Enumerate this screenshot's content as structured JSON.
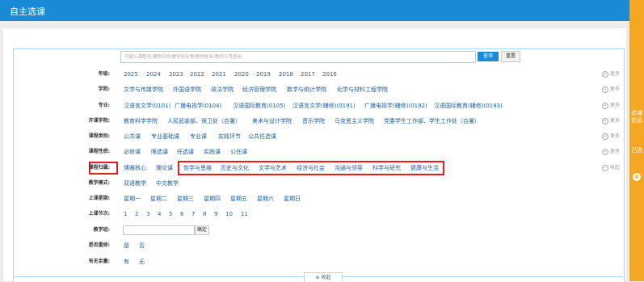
{
  "header": {
    "title": "自主选课"
  },
  "side": {
    "label1": "选课信息",
    "label2": "已选",
    "badge": "0"
  },
  "search": {
    "placeholder": "可输入课程号/课程名称/教学班名称/教师姓名/教师工号查询",
    "query_label": "查询",
    "reset_label": "重置"
  },
  "rows": {
    "grade": {
      "label": "年级:",
      "items": [
        "2025",
        "2024",
        "2023",
        "2022",
        "2021",
        "2020",
        "2019",
        "2018",
        "2017",
        "2016"
      ],
      "more": "更多"
    },
    "college": {
      "label": "学院:",
      "items": [
        "文学与传媒学院",
        "外国语学院",
        "政法学院",
        "经济管理学院",
        "数学与统计学院",
        "化学与材料工程学院"
      ],
      "more": "更多"
    },
    "major": {
      "label": "专业:",
      "items": [
        "汉语言文学(0101)",
        "广播电视学(0104)",
        "汉语国际教育(0105)",
        "汉语言文学(辅修)(0191)",
        "广播电视学(辅修)(0192)",
        "汉语国际教育(辅修)(0193)"
      ],
      "more": "更多"
    },
    "dept": {
      "label": "开课学院:",
      "items": [
        "教育科学学院",
        "人民武装部、保卫处（合署）",
        "美术与设计学院",
        "音乐学院",
        "马克思主义学院",
        "党委学生工作部、学生工作处（合署）"
      ],
      "more": "更多"
    },
    "course_type": {
      "label": "课程类别:",
      "items": [
        "公共课",
        "专业基础课",
        "专业课",
        "实践环节",
        "公共任选课"
      ],
      "more": "更多"
    },
    "course_nature": {
      "label": "课程性质:",
      "items": [
        "必修课",
        "限选课",
        "任选课",
        "实践课",
        "公任课"
      ],
      "more": "更多"
    },
    "course_group": {
      "label": "课程归属:",
      "items": [
        "博雅核心",
        "理论课",
        "哲学与思维",
        "历史与文化",
        "文学与艺术",
        "经济与社会",
        "沟通与领导",
        "科学与研究",
        "健康与生活"
      ],
      "collapse": "收起"
    },
    "teach_mode": {
      "label": "教学模式:",
      "items": [
        "双语教学",
        "中文教学"
      ]
    },
    "weekday": {
      "label": "上课星期:",
      "items": [
        "星期一",
        "星期二",
        "星期三",
        "星期四",
        "星期五",
        "星期六",
        "星期日"
      ]
    },
    "period": {
      "label": "上课节次:",
      "items": [
        "1",
        "2",
        "3",
        "4",
        "5",
        "6",
        "7",
        "8",
        "9",
        "10",
        "11"
      ]
    },
    "class": {
      "label": "教学班:",
      "confirm": "确定"
    },
    "conflict": {
      "label": "是否重修:",
      "items": [
        "是",
        "否"
      ]
    },
    "remain": {
      "label": "有无余量:",
      "items": [
        "有",
        "无"
      ]
    }
  },
  "footer": {
    "collapse": "收起"
  },
  "colors": {
    "header": "#1b8ad6",
    "accent": "#f3a722",
    "highlight": "#e41e1e"
  }
}
